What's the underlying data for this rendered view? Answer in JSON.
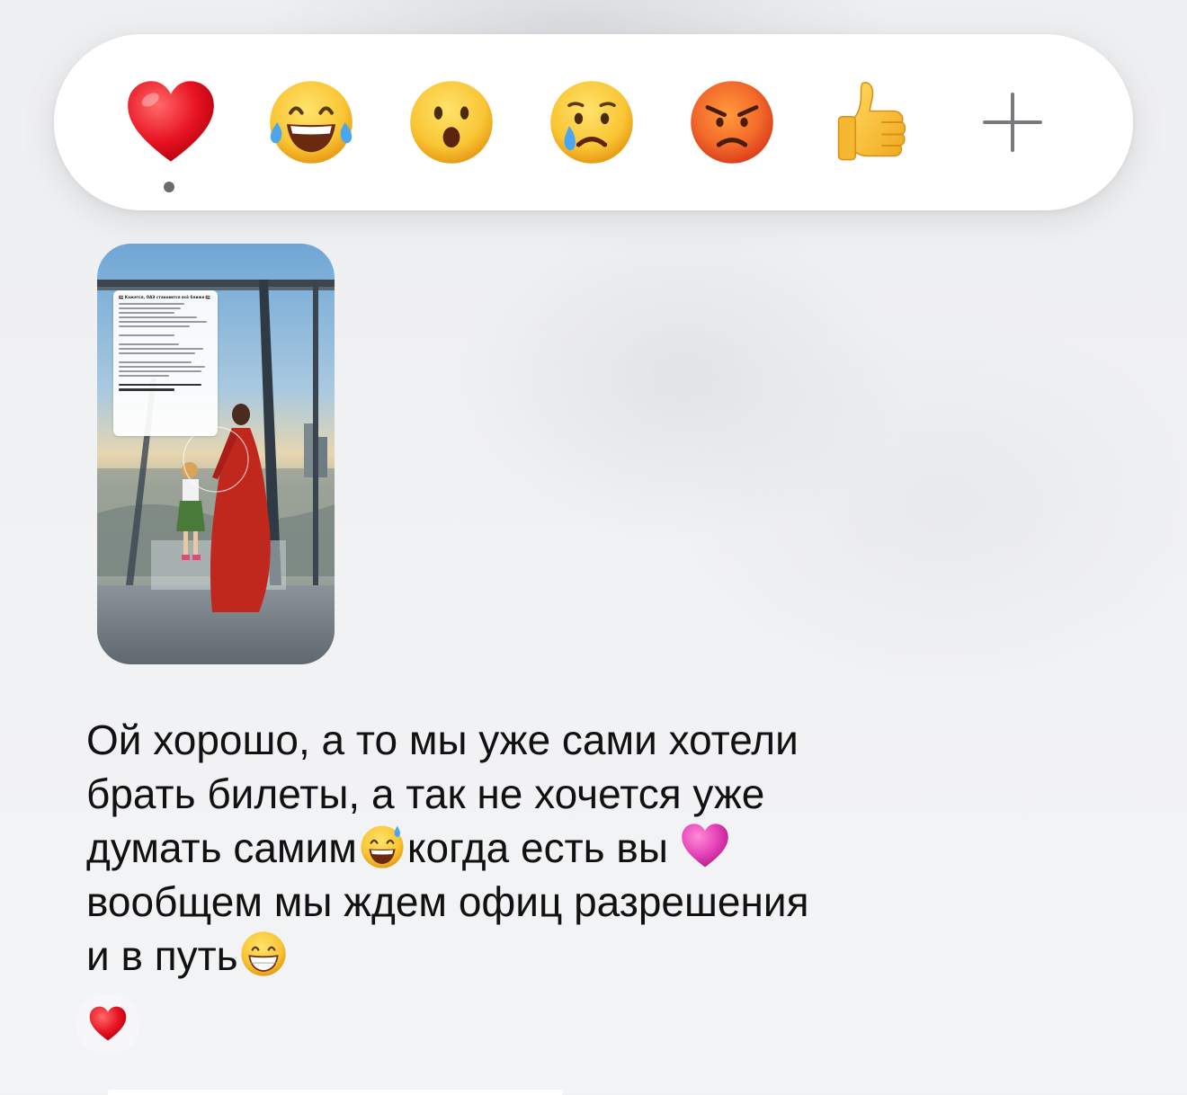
{
  "reaction_bar": {
    "reactions": [
      {
        "name": "heart",
        "icon": "red-heart-icon",
        "selected": true
      },
      {
        "name": "laugh",
        "icon": "face-with-tears-of-joy-icon",
        "selected": false
      },
      {
        "name": "wow",
        "icon": "face-with-open-mouth-icon",
        "selected": false
      },
      {
        "name": "sad",
        "icon": "crying-face-icon",
        "selected": false
      },
      {
        "name": "angry",
        "icon": "pouting-face-icon",
        "selected": false
      },
      {
        "name": "like",
        "icon": "thumbs-up-icon",
        "selected": false
      }
    ],
    "more_icon": "plus-icon"
  },
  "media": {
    "kind": "story-thumbnail",
    "card_title": "🇦🇪 Кажется, ОАЭ становится всё ближе 🇦🇪"
  },
  "message": {
    "lines": [
      "Ой хорошо, а то мы уже сами хотели",
      "брать билеты, а так не хочется уже",
      "думать самим",
      "когда есть вы ",
      "вообщем мы ждем офиц разрешения",
      "и в путь"
    ],
    "reaction_icon": "red-heart-icon"
  }
}
